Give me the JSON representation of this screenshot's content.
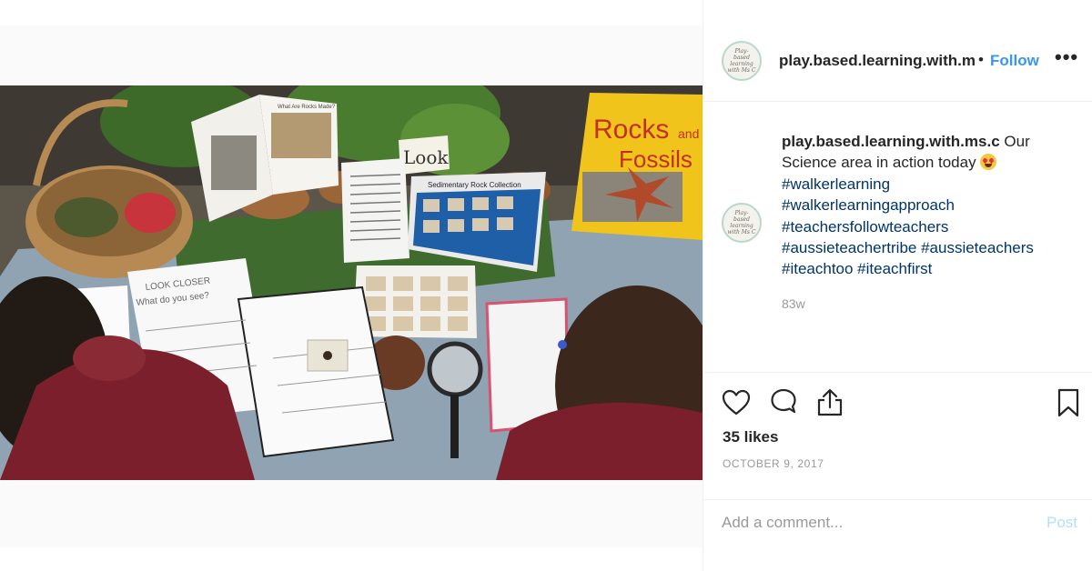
{
  "post": {
    "username": "play.based.learning.with.ms.c",
    "header_username_display": "play.based.learning.with.m",
    "follow_label": "Follow",
    "dot": "•",
    "more_label": "•••",
    "caption": {
      "text_before_emoji": "Our Science area in action today",
      "hashtags": [
        "#walkerlearning",
        "#walkerlearningapproach",
        "#teachersfollowteachers",
        "#aussieteachertribe #aussieteachers",
        "#iteachtoo #iteachfirst"
      ]
    },
    "time_ago": "83w",
    "likes": "35 likes",
    "date": "OCTOBER 9, 2017"
  },
  "avatar_text": "Play-based learning with Ms C",
  "photo": {
    "look_card": "Look",
    "book_title_1": "Rocks",
    "book_title_2": "and",
    "book_title_3": "Fossils",
    "booklet_title": "What Are Rocks Made?",
    "rock_box_title": "Sedimentary Rock Collection",
    "worksheet_heading": "LOOK CLOSER",
    "worksheet_question": "What do you see?"
  },
  "comment": {
    "placeholder": "Add a comment...",
    "post_label": "Post"
  },
  "icons": {
    "like": "heart-icon",
    "comment": "speech-bubble-icon",
    "share": "share-icon",
    "save": "bookmark-icon",
    "more": "more-options-icon"
  },
  "colors": {
    "follow": "#3897f0",
    "hashtag": "#003569",
    "muted": "#999999",
    "post_disabled": "#b2dffc",
    "text": "#262626"
  }
}
